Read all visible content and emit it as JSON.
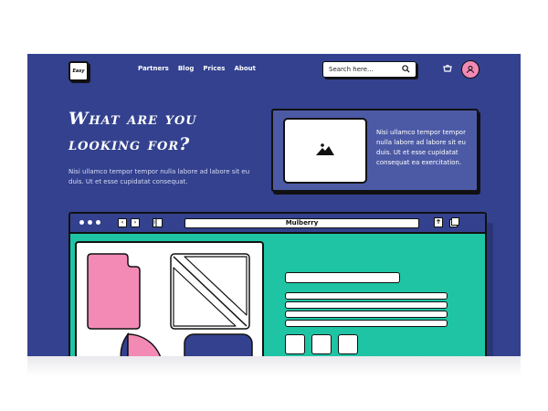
{
  "header": {
    "logo_text": "Easy",
    "nav": [
      {
        "label": "Partners"
      },
      {
        "label": "Blog"
      },
      {
        "label": "Prices"
      },
      {
        "label": "About"
      }
    ],
    "search_placeholder": "Search here...",
    "icons": {
      "search": "search-icon",
      "cart": "cart-icon",
      "user": "user-icon"
    }
  },
  "hero": {
    "title": "What are you looking for?",
    "text": "Nisi ullamco tempor tempor nulla labore ad labore sit eu duis. Ut et esse cupidatat consequat."
  },
  "card": {
    "text": "Nisi ullamco tempor tempor nulla labore ad labore sit eu duis. Ut et esse cupidatat consequat ea exercitation.",
    "icon": "image-icon"
  },
  "browser": {
    "url": "Mulberry",
    "back_glyph": "‹",
    "forward_glyph": "›"
  },
  "colors": {
    "background": "#33418f",
    "accent_teal": "#1ec4a4",
    "accent_pink": "#f28ab5",
    "card": "#4c5aa6"
  }
}
